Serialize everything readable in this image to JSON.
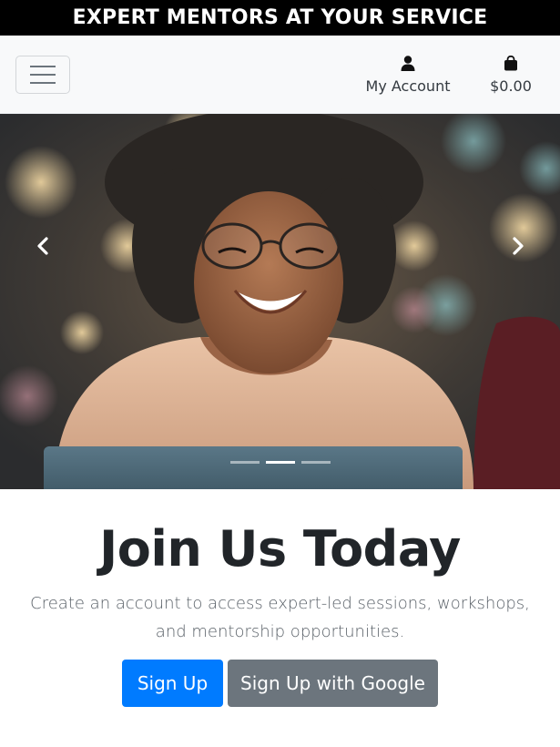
{
  "banner": {
    "text": "EXPERT MENTORS AT YOUR SERVICE"
  },
  "navbar": {
    "toggler_icon": "hamburger-menu-icon",
    "account": {
      "icon": "user-icon",
      "label": "My Account"
    },
    "bag": {
      "icon": "shopping-bag-icon",
      "total": "$0.00"
    }
  },
  "carousel": {
    "prev_icon": "chevron-left-icon",
    "next_icon": "chevron-right-icon",
    "slide_count": 3,
    "active_slide": 2,
    "image": "smiling-woman-with-glasses-at-laptop"
  },
  "join": {
    "heading": "Join Us Today",
    "text": "Create an account to access expert-led sessions, workshops, and mentorship opportunities.",
    "signup_label": "Sign Up",
    "google_label": "Sign Up with Google"
  },
  "colors": {
    "banner_bg": "#000000",
    "primary": "#007bff",
    "secondary": "#6c757d",
    "navbar_bg": "#f8f9fa"
  }
}
